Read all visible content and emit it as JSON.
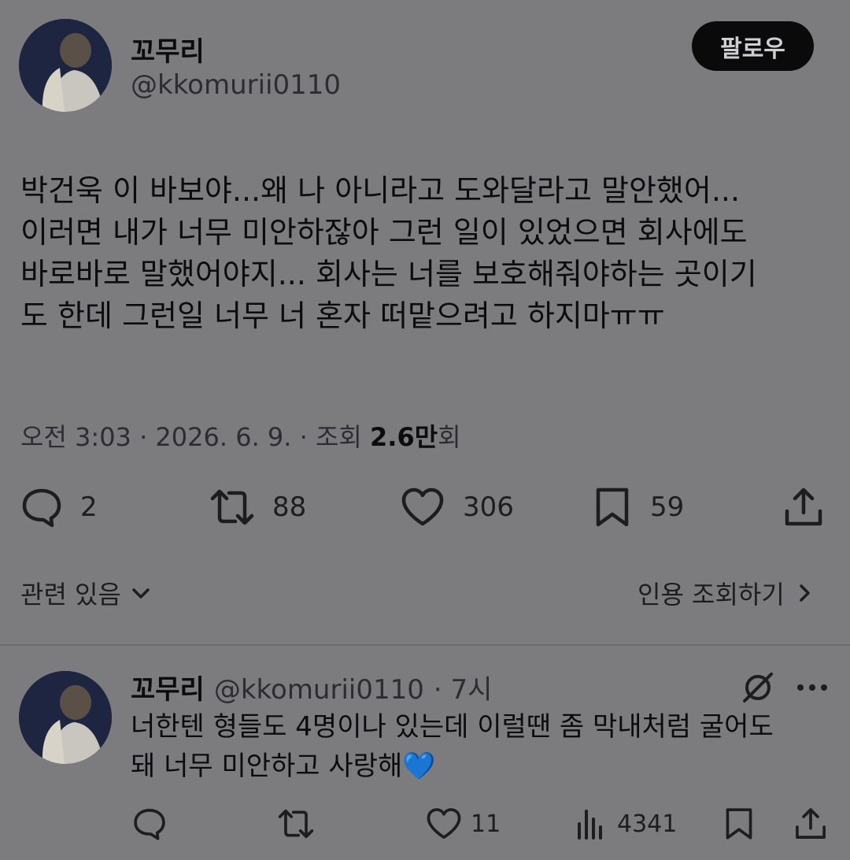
{
  "tweet": {
    "author_name": "꼬무리",
    "author_handle": "@kkomurii0110",
    "follow_label": "팔로우",
    "text": "박건욱 이 바보야...왜 나 아니라고 도와달라고 말안했어...\n이러면 내가 너무 미안하잖아 그런 일이 있었으면 회사에도\n바로바로 말했어야지... 회사는 너를 보호해줘야하는 곳이기\n도 한데 그런일 너무 너 혼자 떠맡으려고 하지마ㅠㅠ",
    "meta_time": "오전 3:03 · 2026. 6. 9. · 조회 ",
    "meta_views": "2.6만",
    "meta_views_suffix": "회",
    "actions": {
      "reply_count": "2",
      "retweet_count": "88",
      "like_count": "306",
      "bookmark_count": "59"
    },
    "related_label": "관련 있음",
    "quotes_label": "인용 조회하기"
  },
  "reply": {
    "author_name": "꼬무리",
    "author_handle": "@kkomurii0110",
    "time": "· 7시",
    "text": "너한텐 형들도 4명이나 있는데 이럴땐 좀 막내처럼 굴어도\n돼 너무 미안하고 사랑해💙",
    "actions": {
      "like_count": "11",
      "views_count": "4341"
    }
  },
  "icons": {
    "reply": "comment-icon",
    "retweet": "retweet-icon",
    "like": "heart-icon",
    "bookmark": "bookmark-icon",
    "share": "share-icon",
    "views": "bar-chart-icon",
    "grok": "grok-icon",
    "more": "more-icon"
  },
  "colors": {
    "background": "#7c7c7f",
    "text": "#0c0c0e",
    "follow_button": "#0a0a0b"
  }
}
